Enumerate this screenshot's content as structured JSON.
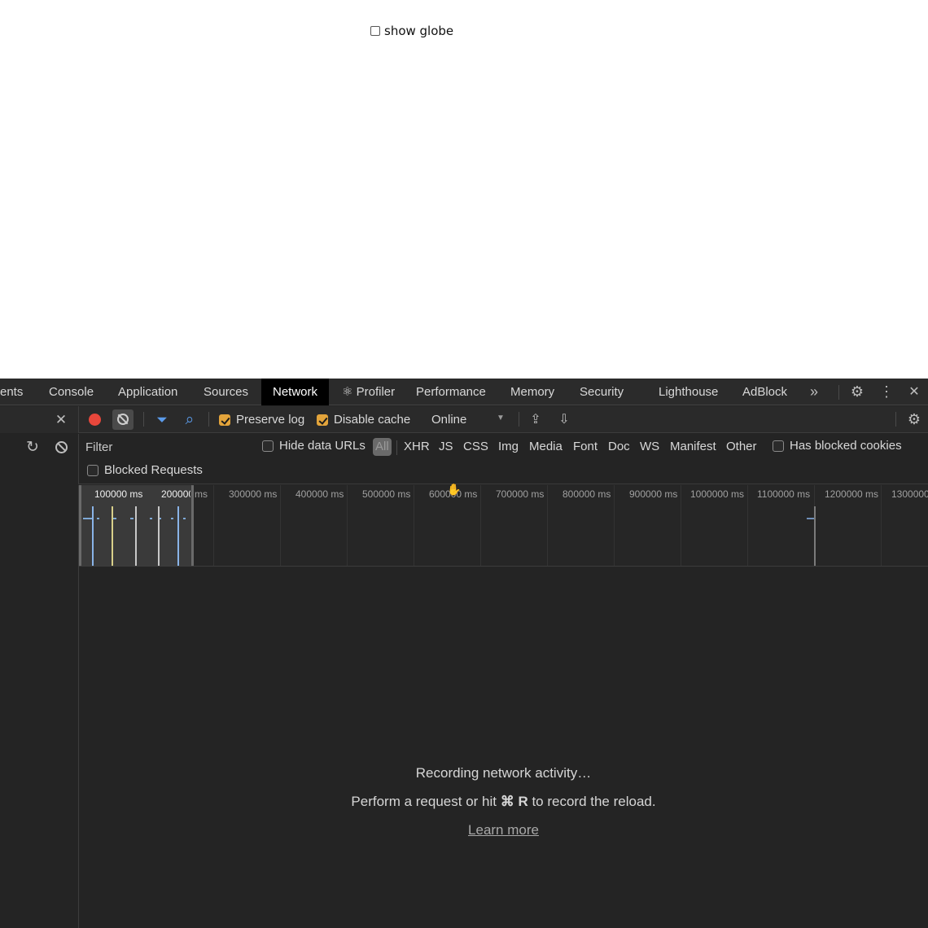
{
  "webpage": {
    "globe_label": "show globe",
    "globe_checked": false
  },
  "devtools": {
    "tabs": [
      {
        "label": "ents",
        "active": false
      },
      {
        "label": "Console",
        "active": false
      },
      {
        "label": "Application",
        "active": false
      },
      {
        "label": "Sources",
        "active": false
      },
      {
        "label": "Network",
        "active": true
      },
      {
        "label": "⚛ Profiler",
        "active": false
      },
      {
        "label": "Performance",
        "active": false
      },
      {
        "label": "Memory",
        "active": false
      },
      {
        "label": "Security",
        "active": false
      },
      {
        "label": "Lighthouse",
        "active": false
      },
      {
        "label": "AdBlock",
        "active": false
      }
    ],
    "icons": {
      "more_tabs": "»",
      "settings": "⚙",
      "menu": "⋮",
      "close": "✕",
      "panel_close": "✕",
      "reload": "↻",
      "upload": "⇪",
      "download": "⇩",
      "filter": "⏷",
      "search": "⌕"
    },
    "toolbar": {
      "preserve_log": {
        "label": "Preserve log",
        "checked": true
      },
      "disable_cache": {
        "label": "Disable cache",
        "checked": true
      },
      "throttling": "Online"
    },
    "filter": {
      "placeholder": "Filter",
      "hide_data_urls": {
        "label": "Hide data URLs",
        "checked": false
      },
      "types": [
        "All",
        "XHR",
        "JS",
        "CSS",
        "Img",
        "Media",
        "Font",
        "Doc",
        "WS",
        "Manifest",
        "Other"
      ],
      "selected_type": "All",
      "has_blocked_cookies": {
        "label": "Has blocked cookies",
        "checked": false
      },
      "blocked_requests": {
        "label": "Blocked Requests",
        "checked": false
      }
    },
    "overview": {
      "ticks": [
        "100000 ms",
        "200000 ms",
        "300000 ms",
        "400000 ms",
        "500000 ms",
        "600000 ms",
        "700000 ms",
        "800000 ms",
        "900000 ms",
        "1000000 ms",
        "1100000 ms",
        "1200000 ms",
        "1300000"
      ]
    },
    "empty_state": {
      "title": "Recording network activity…",
      "hint_prefix": "Perform a request or hit ",
      "hint_keys": "⌘ R",
      "hint_suffix": " to record the reload.",
      "link": "Learn more"
    }
  }
}
